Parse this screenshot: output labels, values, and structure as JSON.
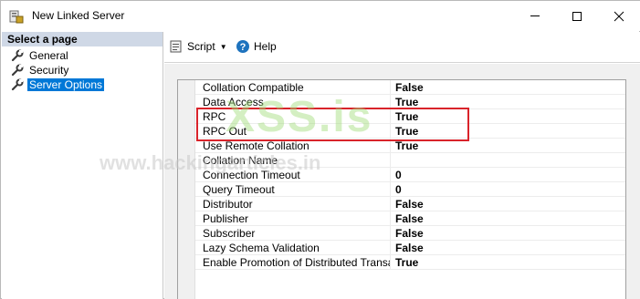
{
  "window": {
    "title": "New Linked Server"
  },
  "left_pane": {
    "header": "Select a page",
    "items": [
      {
        "label": "General",
        "selected": false
      },
      {
        "label": "Security",
        "selected": false
      },
      {
        "label": "Server Options",
        "selected": true
      }
    ]
  },
  "toolbar": {
    "script_label": "Script",
    "help_label": "Help"
  },
  "options": [
    {
      "name": "Collation Compatible",
      "value": "False"
    },
    {
      "name": "Data Access",
      "value": "True"
    },
    {
      "name": "RPC",
      "value": "True"
    },
    {
      "name": "RPC Out",
      "value": "True"
    },
    {
      "name": "Use Remote Collation",
      "value": "True"
    },
    {
      "name": "Collation Name",
      "value": ""
    },
    {
      "name": "Connection Timeout",
      "value": "0"
    },
    {
      "name": "Query Timeout",
      "value": "0"
    },
    {
      "name": "Distributor",
      "value": "False"
    },
    {
      "name": "Publisher",
      "value": "False"
    },
    {
      "name": "Subscriber",
      "value": "False"
    },
    {
      "name": "Lazy Schema Validation",
      "value": "False"
    },
    {
      "name": "Enable Promotion of Distributed Transaction",
      "value": "True"
    }
  ],
  "watermark": {
    "logo_text": "XSS.is",
    "url_text": "www.hackingarticles.in"
  },
  "colors": {
    "selection": "#0078d7",
    "highlight_border": "#d9232a",
    "header_bg": "#cfd8e6"
  }
}
